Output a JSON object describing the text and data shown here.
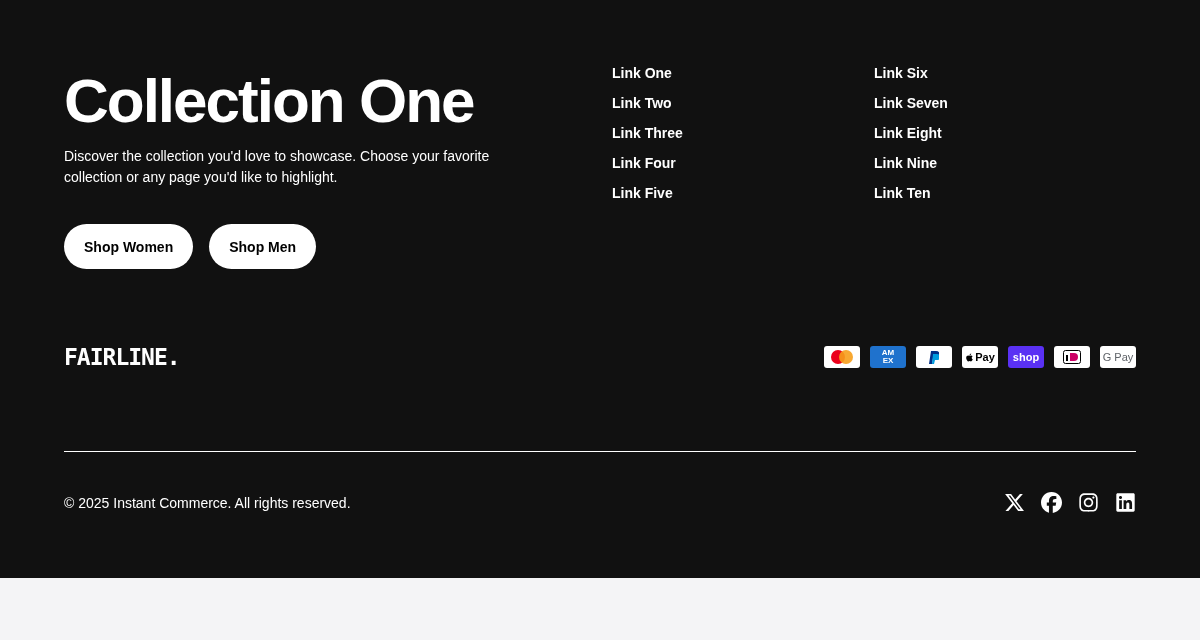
{
  "hero": {
    "title": "Collection One",
    "description": "Discover the collection you'd love to showcase. Choose your favorite collection or any page you'd like to highlight.",
    "buttons": [
      "Shop Women",
      "Shop Men"
    ]
  },
  "links": [
    [
      "Link One",
      "Link Two",
      "Link Three",
      "Link Four",
      "Link Five"
    ],
    [
      "Link Six",
      "Link Seven",
      "Link Eight",
      "Link Nine",
      "Link Ten"
    ]
  ],
  "logo": "FAIRLINE.",
  "payments": [
    {
      "kind": "mastercard"
    },
    {
      "kind": "amex",
      "label": "AM EX"
    },
    {
      "kind": "paypal"
    },
    {
      "kind": "applepay",
      "label": "Pay"
    },
    {
      "kind": "shop",
      "label": "shop"
    },
    {
      "kind": "ideal"
    },
    {
      "kind": "gpay",
      "label": "G Pay"
    }
  ],
  "copyright": "© 2025 Instant Commerce. All rights reserved.",
  "social": [
    {
      "kind": "x"
    },
    {
      "kind": "facebook"
    },
    {
      "kind": "instagram"
    },
    {
      "kind": "linkedin"
    }
  ]
}
